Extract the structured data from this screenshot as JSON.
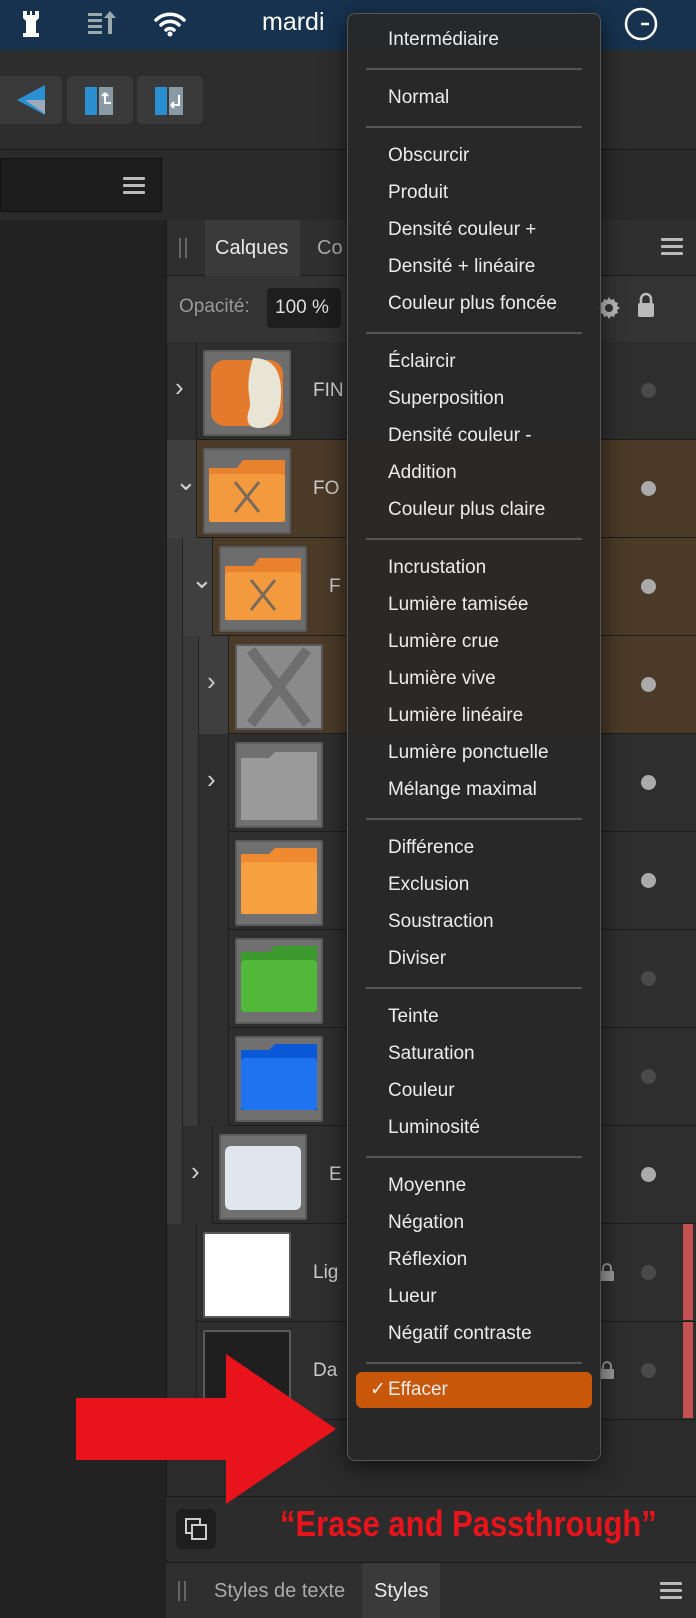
{
  "menubar": {
    "clock_text": "mardi",
    "icons": [
      "castle-icon",
      "stack-arrows-icon",
      "wifi-icon",
      "clock-icon"
    ]
  },
  "panel": {
    "tabs": [
      "Calques",
      "Co"
    ],
    "opacity_label": "Opacité:",
    "opacity_value": "100 %"
  },
  "layers": [
    {
      "name": "FIN",
      "thumb": "photo-folder",
      "expand": ">",
      "indent": 0,
      "selected": false
    },
    {
      "name": "FO",
      "thumb": "folder-x-orange",
      "expand": "v",
      "indent": 0,
      "selected": true
    },
    {
      "name": "F",
      "thumb": "folder-x-orange",
      "expand": "v",
      "indent": 1,
      "selected": true
    },
    {
      "name": "",
      "thumb": "x-gray",
      "expand": ">",
      "indent": 2,
      "selected": true
    },
    {
      "name": "",
      "thumb": "folder-gray",
      "expand": ">",
      "indent": 2,
      "selected": false
    },
    {
      "name": "",
      "thumb": "folder-orange",
      "expand": "",
      "indent": 2,
      "selected": false
    },
    {
      "name": "",
      "thumb": "folder-green",
      "expand": "",
      "indent": 2,
      "selected": false
    },
    {
      "name": "",
      "thumb": "folder-blue",
      "expand": "",
      "indent": 2,
      "selected": false
    },
    {
      "name": "E",
      "thumb": "folder-white",
      "expand": ">",
      "indent": 1,
      "selected": false
    },
    {
      "name": "Lig",
      "thumb": "white",
      "expand": "",
      "indent": 0,
      "selected": false
    },
    {
      "name": "Da",
      "thumb": "dark",
      "expand": "",
      "indent": 0,
      "selected": false
    }
  ],
  "blend_menu": {
    "groups": [
      [
        "Intermédiaire"
      ],
      [
        "Normal"
      ],
      [
        "Obscurcir",
        "Produit",
        "Densité couleur +",
        "Densité + linéaire",
        "Couleur plus foncée"
      ],
      [
        "Éclaircir",
        "Superposition",
        "Densité couleur -",
        "Addition",
        "Couleur plus claire"
      ],
      [
        "Incrustation",
        "Lumière tamisée",
        "Lumière crue",
        "Lumière vive",
        "Lumière linéaire",
        "Lumière ponctuelle",
        "Mélange maximal"
      ],
      [
        "Différence",
        "Exclusion",
        "Soustraction",
        "Diviser"
      ],
      [
        "Teinte",
        "Saturation",
        "Couleur",
        "Luminosité"
      ],
      [
        "Moyenne",
        "Négation",
        "Réflexion",
        "Lueur",
        "Négatif contraste"
      ]
    ],
    "selected": "Effacer",
    "check": "✓"
  },
  "bottom_tabs": [
    "Styles de texte",
    "Styles"
  ],
  "annotation": {
    "caption": "“Erase and Passthrough”"
  },
  "colors": {
    "menubar": "#17324f",
    "selected_item": "#c8570a",
    "annotation_red": "#e8131b"
  }
}
